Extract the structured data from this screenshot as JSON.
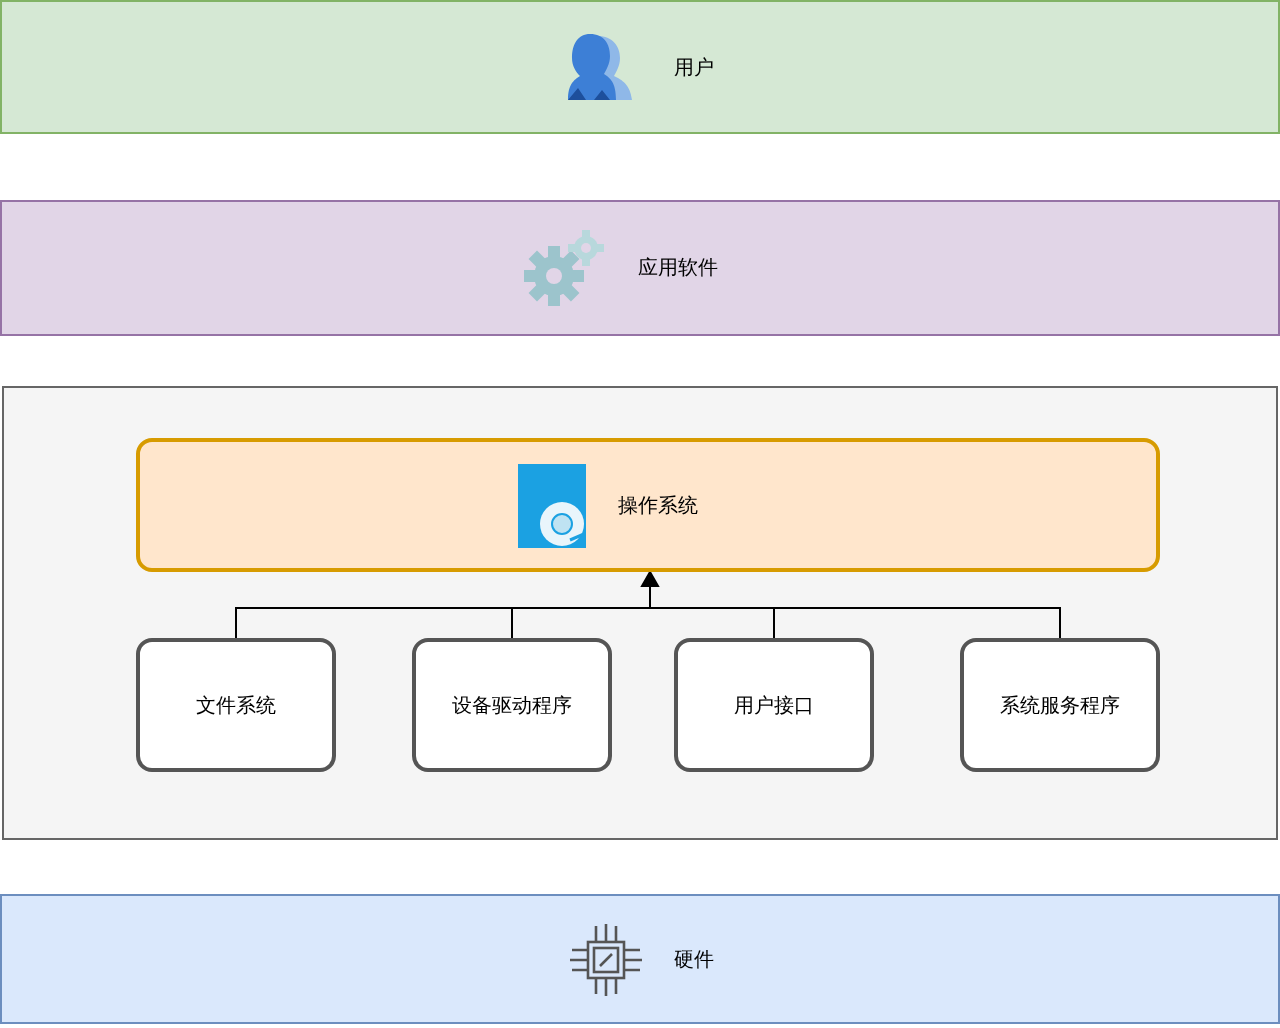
{
  "layers": [
    {
      "kind": "user",
      "label": "用户",
      "color": "#d5e8d4"
    },
    {
      "kind": "software",
      "label": "应用软件",
      "color": "#e1d5e7"
    },
    {
      "kind": "os",
      "label": "操作系统",
      "components": [
        "文件系统",
        "设备驱动程序",
        "用户接口",
        "系统服务程序"
      ]
    },
    {
      "kind": "hardware",
      "label": "硬件",
      "color": "#dae8fc"
    }
  ]
}
